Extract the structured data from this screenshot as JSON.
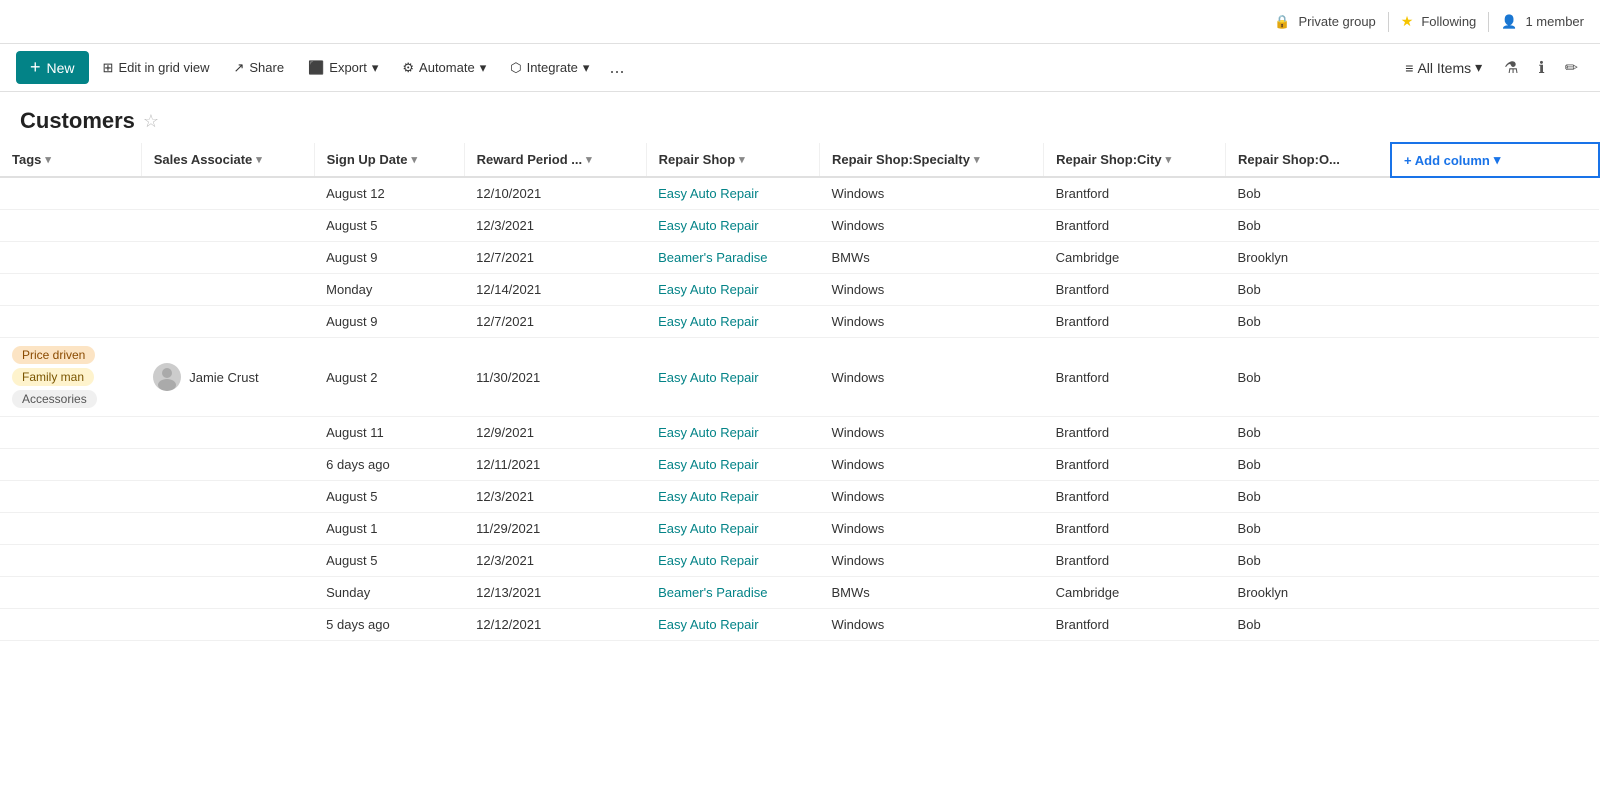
{
  "topbar": {
    "private_group": "Private group",
    "following": "Following",
    "member_count": "1 member"
  },
  "toolbar": {
    "new_label": "New",
    "edit_grid_label": "Edit in grid view",
    "share_label": "Share",
    "export_label": "Export",
    "automate_label": "Automate",
    "integrate_label": "Integrate",
    "more_label": "...",
    "all_items_label": "All Items"
  },
  "page": {
    "title": "Customers"
  },
  "table": {
    "columns": [
      {
        "label": "Tags",
        "has_chevron": true
      },
      {
        "label": "Sales Associate",
        "has_chevron": true
      },
      {
        "label": "Sign Up Date",
        "has_chevron": true
      },
      {
        "label": "Reward Period ...",
        "has_chevron": true
      },
      {
        "label": "Repair Shop",
        "has_chevron": true
      },
      {
        "label": "Repair Shop:Specialty",
        "has_chevron": true
      },
      {
        "label": "Repair Shop:City",
        "has_chevron": true
      },
      {
        "label": "Repair Shop:O...",
        "has_chevron": false
      }
    ],
    "add_column_label": "+ Add column",
    "rows": [
      {
        "tags": [],
        "associate": "",
        "sign_up": "August 12",
        "reward": "12/10/2021",
        "shop": "Easy Auto Repair",
        "specialty": "Windows",
        "city": "Brantford",
        "other": "Bob"
      },
      {
        "tags": [],
        "associate": "",
        "sign_up": "August 5",
        "reward": "12/3/2021",
        "shop": "Easy Auto Repair",
        "specialty": "Windows",
        "city": "Brantford",
        "other": "Bob"
      },
      {
        "tags": [],
        "associate": "",
        "sign_up": "August 9",
        "reward": "12/7/2021",
        "shop": "Beamer's Paradise",
        "specialty": "BMWs",
        "city": "Cambridge",
        "other": "Brooklyn"
      },
      {
        "tags": [],
        "associate": "",
        "sign_up": "Monday",
        "reward": "12/14/2021",
        "shop": "Easy Auto Repair",
        "specialty": "Windows",
        "city": "Brantford",
        "other": "Bob"
      },
      {
        "tags": [],
        "associate": "",
        "sign_up": "August 9",
        "reward": "12/7/2021",
        "shop": "Easy Auto Repair",
        "specialty": "Windows",
        "city": "Brantford",
        "other": "Bob"
      },
      {
        "tags": [
          "Price driven",
          "Family man",
          "Accessories"
        ],
        "associate": "Jamie Crust",
        "sign_up": "August 2",
        "reward": "11/30/2021",
        "shop": "Easy Auto Repair",
        "specialty": "Windows",
        "city": "Brantford",
        "other": "Bob"
      },
      {
        "tags": [],
        "associate": "",
        "sign_up": "August 11",
        "reward": "12/9/2021",
        "shop": "Easy Auto Repair",
        "specialty": "Windows",
        "city": "Brantford",
        "other": "Bob"
      },
      {
        "tags": [],
        "associate": "",
        "sign_up": "6 days ago",
        "reward": "12/11/2021",
        "shop": "Easy Auto Repair",
        "specialty": "Windows",
        "city": "Brantford",
        "other": "Bob"
      },
      {
        "tags": [],
        "associate": "",
        "sign_up": "August 5",
        "reward": "12/3/2021",
        "shop": "Easy Auto Repair",
        "specialty": "Windows",
        "city": "Brantford",
        "other": "Bob"
      },
      {
        "tags": [],
        "associate": "",
        "sign_up": "August 1",
        "reward": "11/29/2021",
        "shop": "Easy Auto Repair",
        "specialty": "Windows",
        "city": "Brantford",
        "other": "Bob"
      },
      {
        "tags": [],
        "associate": "",
        "sign_up": "August 5",
        "reward": "12/3/2021",
        "shop": "Easy Auto Repair",
        "specialty": "Windows",
        "city": "Brantford",
        "other": "Bob"
      },
      {
        "tags": [],
        "associate": "",
        "sign_up": "Sunday",
        "reward": "12/13/2021",
        "shop": "Beamer's Paradise",
        "specialty": "BMWs",
        "city": "Cambridge",
        "other": "Brooklyn"
      },
      {
        "tags": [],
        "associate": "",
        "sign_up": "5 days ago",
        "reward": "12/12/2021",
        "shop": "Easy Auto Repair",
        "specialty": "Windows",
        "city": "Brantford",
        "other": "Bob"
      }
    ],
    "tag_styles": {
      "Price driven": "tag-orange",
      "Family man": "tag-yellow",
      "Accessories": "tag-gray"
    }
  }
}
